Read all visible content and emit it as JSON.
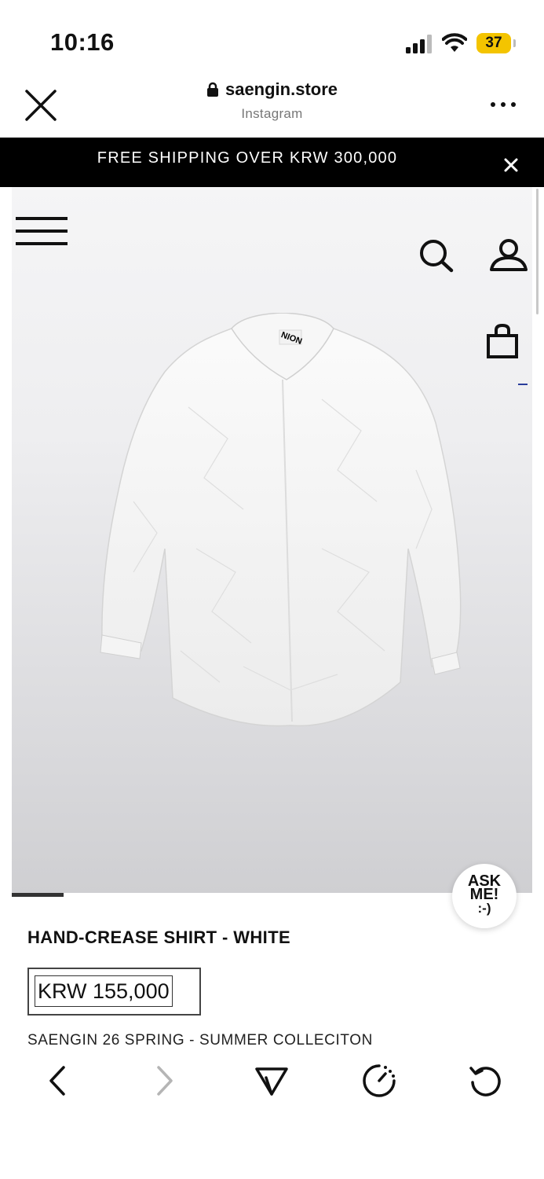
{
  "status": {
    "time": "10:16",
    "battery": "37"
  },
  "browser": {
    "domain": "saengin.store",
    "source": "Instagram"
  },
  "promo": {
    "text": "FREE SHIPPING OVER KRW 300,000"
  },
  "product": {
    "title": "HAND-CREASE SHIRT - WHITE",
    "price": "KRW 155,000",
    "collection": "SAENGIN 26 SPRING - SUMMER COLLECITON",
    "label_text": "NION"
  },
  "chat": {
    "line1": "ASK",
    "line2": "ME!",
    "line3": ":-)"
  },
  "icons": {
    "close": "close-icon",
    "lock": "lock-icon",
    "more": "more-icon",
    "menu": "hamburger-icon",
    "search": "search-icon",
    "account": "user-icon",
    "bag": "bag-icon",
    "back": "chevron-left-icon",
    "forward": "chevron-right-icon",
    "share": "send-icon",
    "timer": "timer-icon",
    "reload": "reload-icon"
  },
  "colors": {
    "promo_bg": "#000000",
    "battery": "#f4c400",
    "accent_line": "#2a3d9b"
  }
}
